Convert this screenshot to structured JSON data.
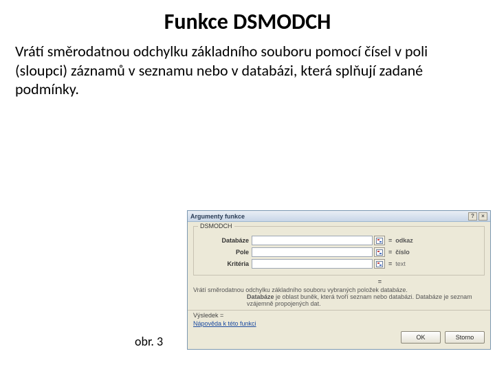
{
  "title": "Funkce DSMODCH",
  "description": "Vrátí směrodatnou odchylku základního souboru pomocí čísel v poli (sloupci) záznamů v seznamu nebo v databázi, která splňují zadané podmínky.",
  "caption": "obr. 3",
  "dialog": {
    "titlebar": "Argumenty funkce",
    "help_icon": "?",
    "close_icon": "×",
    "group_label": "DSMODCH",
    "fields": {
      "db_label": "Databáze",
      "db_hint": "odkaz",
      "pole_label": "Pole",
      "pole_hint": "číslo",
      "krit_label": "Kritéria",
      "krit_hint": "text"
    },
    "eq_symbol": "=",
    "explain_line1": "Vrátí směrodatnou odchylku základního souboru vybraných položek databáze.",
    "explain_bold": "Databáze",
    "explain_rest": " je oblast buněk, která tvoří seznam nebo databázi. Databáze je seznam vzájemně propojených dat.",
    "result_label": "Výsledek =",
    "help_link": "Nápověda k této funkci",
    "ok": "OK",
    "cancel": "Storno"
  }
}
